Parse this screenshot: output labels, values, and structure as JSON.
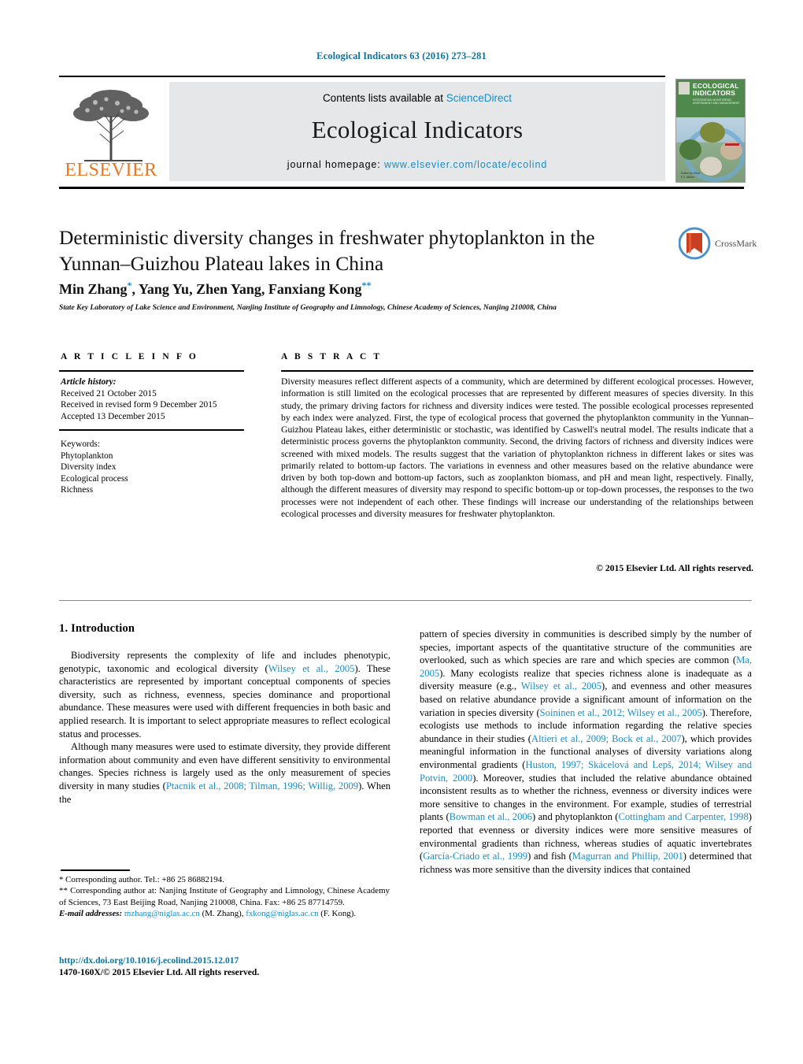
{
  "running_head": "Ecological Indicators 63 (2016) 273–281",
  "masthead": {
    "contents_prefix": "Contents lists available at ",
    "sciencedirect": "ScienceDirect",
    "journal_title": "Ecological Indicators",
    "homepage_prefix": "journal homepage: ",
    "homepage_url": "www.elsevier.com/locate/ecolind",
    "publisher": "ELSEVIER",
    "cover": {
      "line1": "ECOLOGICAL",
      "line2": "INDICATORS",
      "subtitle": "INTEGRATING MONITORING, ASSESSMENT AND MANAGEMENT",
      "footer": "Editor-in-Chief\nF.J. Müller"
    },
    "colors": {
      "link": "#1a8bc4",
      "elsevier_orange": "#e87722",
      "panel_gray": "#e6e7e8",
      "cover_green": "#4f8a4c"
    }
  },
  "article": {
    "title": "Deterministic diversity changes in freshwater phytoplankton in the Yunnan–Guizhou Plateau lakes in China",
    "authors": "Min Zhang, Yang Yu, Zhen Yang, Fanxiang Kong",
    "author_marks": {
      "first": "*",
      "last": "**"
    },
    "affiliation": "State Key Laboratory of Lake Science and Environment, Nanjing Institute of Geography and Limnology, Chinese Academy of Sciences, Nanjing 210008, China",
    "crossmark_label": "CrossMark"
  },
  "article_info": {
    "heading": "A R T I C L E   I N F O",
    "history_label": "Article history:",
    "history": [
      "Received 21 October 2015",
      "Received in revised form 9 December 2015",
      "Accepted 13 December 2015"
    ],
    "keywords_label": "Keywords:",
    "keywords": [
      "Phytoplankton",
      "Diversity index",
      "Ecological process",
      "Richness"
    ]
  },
  "abstract": {
    "heading": "A B S T R A C T",
    "text": "Diversity measures reflect different aspects of a community, which are determined by different ecological processes. However, information is still limited on the ecological processes that are represented by different measures of species diversity. In this study, the primary driving factors for richness and diversity indices were tested. The possible ecological processes represented by each index were analyzed. First, the type of ecological process that governed the phytoplankton community in the Yunnan–Guizhou Plateau lakes, either deterministic or stochastic, was identified by Caswell's neutral model. The results indicate that a deterministic process governs the phytoplankton community. Second, the driving factors of richness and diversity indices were screened with mixed models. The results suggest that the variation of phytoplankton richness in different lakes or sites was primarily related to bottom-up factors. The variations in evenness and other measures based on the relative abundance were driven by both top-down and bottom-up factors, such as zooplankton biomass, and pH and mean light, respectively. Finally, although the different measures of diversity may respond to specific bottom-up or top-down processes, the responses to the two processes were not independent of each other. These findings will increase our understanding of the relationships between ecological processes and diversity measures for freshwater phytoplankton.",
    "copyright": "© 2015 Elsevier Ltd. All rights reserved."
  },
  "introduction": {
    "heading": "1. Introduction",
    "left_paragraphs": [
      {
        "segments": [
          {
            "t": "Biodiversity represents the complexity of life and includes phenotypic, genotypic, taxonomic and ecological diversity (",
            "c": false
          },
          {
            "t": "Wilsey et al., 2005",
            "c": true
          },
          {
            "t": "). These characteristics are represented by important conceptual components of species diversity, such as richness, evenness, species dominance and proportional abundance. These measures were used with different frequencies in both basic and applied research. It is important to select appropriate measures to reflect ecological status and processes.",
            "c": false
          }
        ]
      },
      {
        "segments": [
          {
            "t": "Although many measures were used to estimate diversity, they provide different information about community and even have different sensitivity to environmental changes. Species richness is largely used as the only measurement of species diversity in many studies (",
            "c": false
          },
          {
            "t": "Ptacnik et al., 2008; Tilman, 1996; Willig, 2009",
            "c": true
          },
          {
            "t": "). When the",
            "c": false
          }
        ]
      }
    ],
    "right_paragraphs": [
      {
        "segments": [
          {
            "t": "pattern of species diversity in communities is described simply by the number of species, important aspects of the quantitative structure of the communities are overlooked, such as which species are rare and which species are common (",
            "c": false
          },
          {
            "t": "Ma, 2005",
            "c": true
          },
          {
            "t": "). Many ecologists realize that species richness alone is inadequate as a diversity measure (e.g., ",
            "c": false
          },
          {
            "t": "Wilsey et al., 2005",
            "c": true
          },
          {
            "t": "), and evenness and other measures based on relative abundance provide a significant amount of information on the variation in species diversity (",
            "c": false
          },
          {
            "t": "Soininen et al., 2012; Wilsey et al., 2005",
            "c": true
          },
          {
            "t": "). Therefore, ecologists use methods to include information regarding the relative species abundance in their studies (",
            "c": false
          },
          {
            "t": "Altieri et al., 2009; Bock et al., 2007",
            "c": true
          },
          {
            "t": "), which provides meaningful information in the functional analyses of diversity variations along environmental gradients (",
            "c": false
          },
          {
            "t": "Huston, 1997; Skácelová and Lepš, 2014; Wilsey and Potvin, 2000",
            "c": true
          },
          {
            "t": "). Moreover, studies that included the relative abundance obtained inconsistent results as to whether the richness, evenness or diversity indices were more sensitive to changes in the environment. For example, studies of terrestrial plants (",
            "c": false
          },
          {
            "t": "Bowman et al., 2006",
            "c": true
          },
          {
            "t": ") and phytoplankton (",
            "c": false
          },
          {
            "t": "Cottingham and Carpenter, 1998",
            "c": true
          },
          {
            "t": ") reported that evenness or diversity indices were more sensitive measures of environmental gradients than richness, whereas studies of aquatic invertebrates (",
            "c": false
          },
          {
            "t": "García-Criado et al., 1999",
            "c": true
          },
          {
            "t": ") and fish (",
            "c": false
          },
          {
            "t": "Magurran and Phillip, 2001",
            "c": true
          },
          {
            "t": ") determined that richness was more sensitive than the diversity indices that contained",
            "c": false
          }
        ]
      }
    ]
  },
  "footnotes": {
    "line1": "* Corresponding author. Tel.: +86 25 86882194.",
    "line2": "** Corresponding author at: Nanjing Institute of Geography and Limnology, Chinese Academy of Sciences, 73 East Beijing Road, Nanjing 210008, China. Fax: +86 25 87714759.",
    "email_label": "E-mail addresses:",
    "email1": "mzhang@niglas.ac.cn",
    "email1_owner": "(M. Zhang),",
    "email2": "fxkong@niglas.ac.cn",
    "email2_owner": "(F. Kong)."
  },
  "footer": {
    "doi": "http://dx.doi.org/10.1016/j.ecolind.2015.12.017",
    "issn": "1470-160X/© 2015 Elsevier Ltd. All rights reserved."
  }
}
